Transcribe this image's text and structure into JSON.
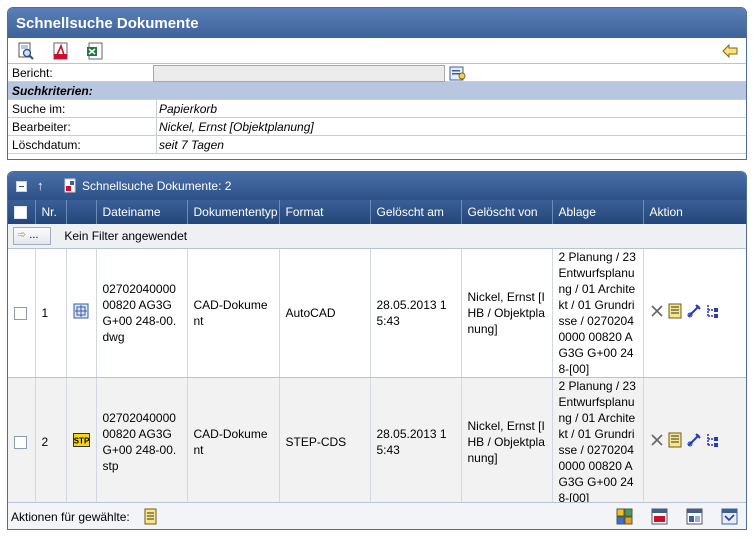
{
  "window": {
    "title": "Schnellsuche Dokumente"
  },
  "toolbar": {
    "buttons": [
      "search-document-icon",
      "pdf-export-icon",
      "excel-export-icon"
    ],
    "back_icon": "arrow-left-icon"
  },
  "form": {
    "bericht_label": "Bericht:",
    "bericht_value": "",
    "section_label": "Suchkriterien:",
    "rows": [
      {
        "label": "Suche im:",
        "value": "Papierkorb"
      },
      {
        "label": "Bearbeiter:",
        "value": "Nickel, Ernst [Objektplanung]"
      },
      {
        "label": "Löschdatum:",
        "value": "seit 7 Tagen"
      }
    ]
  },
  "results": {
    "title": "Schnellsuche Dokumente: 2",
    "columns": [
      "Nr.",
      "Dateiname",
      "Dokumententyp",
      "Format",
      "Gelöscht am",
      "Gelöscht von",
      "Ablage",
      "Aktion"
    ],
    "filter_button": "...",
    "filter_text": "Kein Filter angewendet",
    "rows": [
      {
        "nr": "1",
        "icon": "dwg-file-icon",
        "dateiname": "02702040000 00820 AG3G G+00 248-00.dwg",
        "typ": "CAD-Dokument",
        "format": "AutoCAD",
        "geloescht_am": "28.05.2013 15:43",
        "geloescht_von": "Nickel, Ernst [IHB / Objektplanung]",
        "ablage": "2 Planung / 23 Entwurfsplanung / 01 Architekt / 01 Grundrisse / 02702040000 00820 AG3G G+00 248-[00]"
      },
      {
        "nr": "2",
        "icon": "stp-file-icon",
        "dateiname": "02702040000 00820 AG3G G+00 248-00.stp",
        "typ": "CAD-Dokument",
        "format": "STEP-CDS",
        "geloescht_am": "28.05.2013 15:43",
        "geloescht_von": "Nickel, Ernst [IHB / Objektplanung]",
        "ablage": "2 Planung / 23 Entwurfsplanung / 01 Architekt / 01 Grundrisse / 02702040000 00820 AG3G G+00 248-[00]"
      }
    ]
  },
  "footer": {
    "label": "Aktionen für gewählte:"
  },
  "colors": {
    "header_blue": "#3d6399",
    "section_bg": "#b8c7df"
  }
}
